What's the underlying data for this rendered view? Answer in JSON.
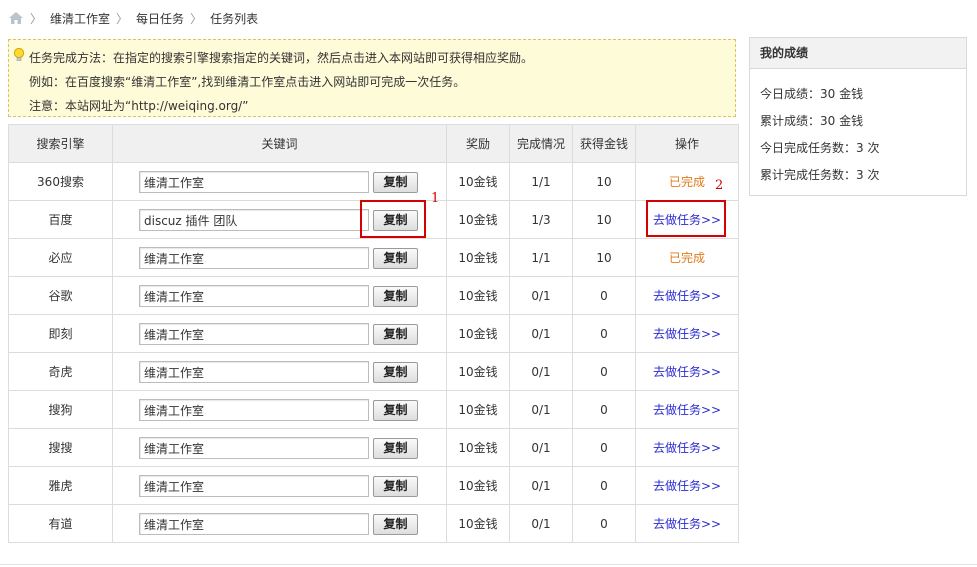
{
  "breadcrumb": {
    "home_icon": "home-icon",
    "items": [
      "维清工作室",
      "每日任务",
      "任务列表"
    ]
  },
  "notice": {
    "icon": "lightbulb-icon",
    "lines": [
      "任务完成方法：在指定的搜索引擎搜索指定的关键词，然后点击进入本网站即可获得相应奖励。",
      "例如：在百度搜索“维清工作室”,找到维清工作室点击进入网站即可完成一次任务。",
      "注意：本站网址为“http://weiqing.org/”"
    ]
  },
  "table": {
    "headers": [
      "搜索引擎",
      "关键词",
      "奖励",
      "完成情况",
      "获得金钱",
      "操作"
    ],
    "copy_label": "复制",
    "rows": [
      {
        "engine": "360搜索",
        "keyword": "维清工作室",
        "reward": "10金钱",
        "progress": "1/1",
        "earned": "10",
        "action": "已完成",
        "done": true
      },
      {
        "engine": "百度",
        "keyword": "discuz 插件 团队",
        "reward": "10金钱",
        "progress": "1/3",
        "earned": "10",
        "action": "去做任务>>",
        "done": false
      },
      {
        "engine": "必应",
        "keyword": "维清工作室",
        "reward": "10金钱",
        "progress": "1/1",
        "earned": "10",
        "action": "已完成",
        "done": true
      },
      {
        "engine": "谷歌",
        "keyword": "维清工作室",
        "reward": "10金钱",
        "progress": "0/1",
        "earned": "0",
        "action": "去做任务>>",
        "done": false
      },
      {
        "engine": "即刻",
        "keyword": "维清工作室",
        "reward": "10金钱",
        "progress": "0/1",
        "earned": "0",
        "action": "去做任务>>",
        "done": false
      },
      {
        "engine": "奇虎",
        "keyword": "维清工作室",
        "reward": "10金钱",
        "progress": "0/1",
        "earned": "0",
        "action": "去做任务>>",
        "done": false
      },
      {
        "engine": "搜狗",
        "keyword": "维清工作室",
        "reward": "10金钱",
        "progress": "0/1",
        "earned": "0",
        "action": "去做任务>>",
        "done": false
      },
      {
        "engine": "搜搜",
        "keyword": "维清工作室",
        "reward": "10金钱",
        "progress": "0/1",
        "earned": "0",
        "action": "去做任务>>",
        "done": false
      },
      {
        "engine": "雅虎",
        "keyword": "维清工作室",
        "reward": "10金钱",
        "progress": "0/1",
        "earned": "0",
        "action": "去做任务>>",
        "done": false
      },
      {
        "engine": "有道",
        "keyword": "维清工作室",
        "reward": "10金钱",
        "progress": "0/1",
        "earned": "0",
        "action": "去做任务>>",
        "done": false
      }
    ]
  },
  "annotations": {
    "label_1": "1",
    "label_2": "2",
    "color": "#d60000"
  },
  "stats": {
    "title": "我的成绩",
    "rows": [
      "今日成绩：30 金钱",
      "累计成绩：30 金钱",
      "今日完成任务数：3 次",
      "累计完成任务数：3 次"
    ]
  },
  "colors": {
    "done": "#e07b1a",
    "link": "#2a2ad0",
    "notice_bg": "#fefbd8",
    "header_bg": "#f0f0f0"
  }
}
